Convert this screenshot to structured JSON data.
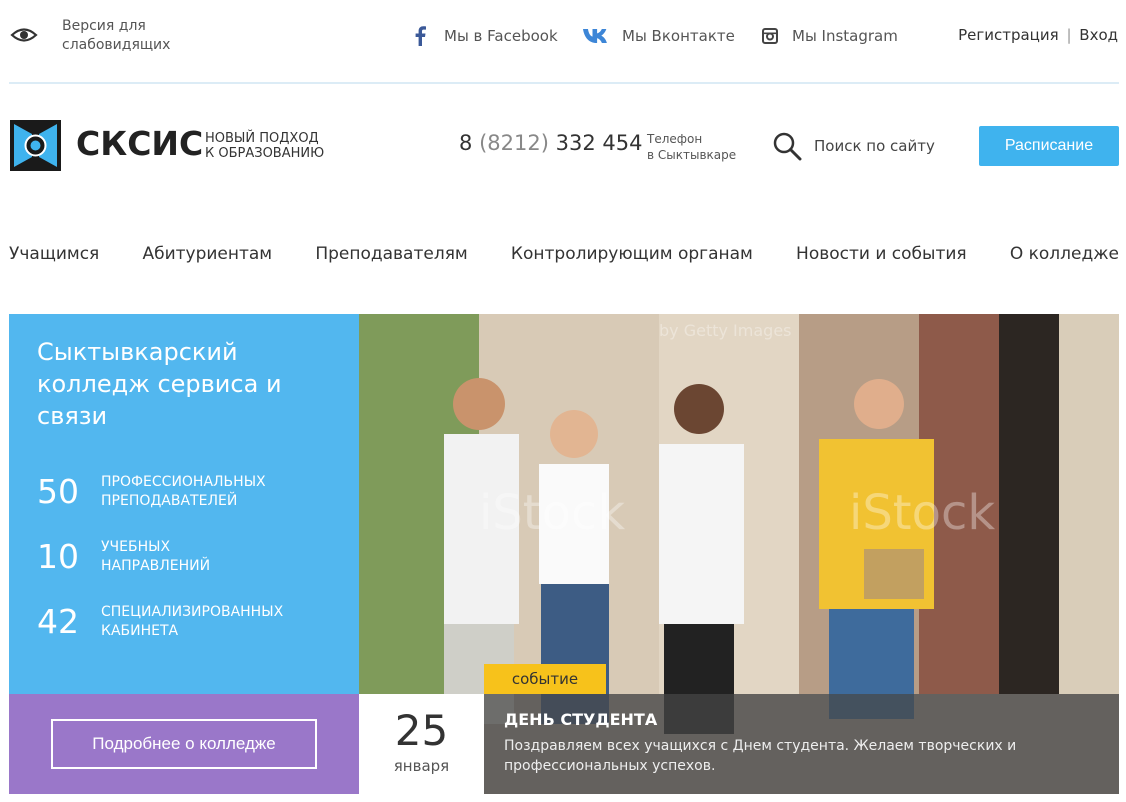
{
  "topbar": {
    "vision_label": "Версия для слабовидящих",
    "facebook_label": "Мы в Facebook",
    "vk_label": "Мы Вконтакте",
    "instagram_label": "Мы Instagram",
    "register_label": "Регистрация",
    "separator": "|",
    "login_label": "Вход"
  },
  "header": {
    "brand": "СКСИС",
    "tagline_line1": "НОВЫЙ ПОДХОД",
    "tagline_line2": "К ОБРАЗОВАНИЮ",
    "phone_prefix": "8",
    "phone_code": "(8212)",
    "phone_number": "332 454",
    "phone_label_line1": "Телефон",
    "phone_label_line2": "в Сыктывкаре",
    "search_label": "Поиск по сайту",
    "schedule_button": "Расписание"
  },
  "nav": {
    "items": [
      {
        "label": "Учащимся"
      },
      {
        "label": "Абитуриентам"
      },
      {
        "label": "Преподавателям"
      },
      {
        "label": "Контролирующим органам"
      },
      {
        "label": "Новости и события"
      },
      {
        "label": "О колледже"
      }
    ]
  },
  "hero": {
    "title": "Сыктывкарский колледж сервиса и связи",
    "stats": [
      {
        "number": "50",
        "line1": "ПРОФЕССИОНАЛЬНЫХ",
        "line2": "ПРЕПОДАВАТЕЛЕЙ"
      },
      {
        "number": "10",
        "line1": "УЧЕБНЫХ",
        "line2": "НАПРАВЛЕНИЙ"
      },
      {
        "number": "42",
        "line1": "СПЕЦИАЛИЗИРОВАННЫХ",
        "line2": "КАБИНЕТА"
      }
    ],
    "more_button": "Подробнее о колледже",
    "watermark": "iStock",
    "watermark_sub": "by Getty Images"
  },
  "event": {
    "tag": "событие",
    "day": "25",
    "month": "января",
    "title": "ДЕНЬ СТУДЕНТА",
    "text": "Поздравляем всех учащихся с Днем студента. Желаем творческих и профессиональных успехов."
  },
  "colors": {
    "accent_blue": "#3fb3ee",
    "panel_purple": "#9a77c9",
    "tag_yellow": "#f7c21b"
  },
  "icons": {
    "vision": "eye-icon",
    "facebook": "facebook-icon",
    "vk": "vk-icon",
    "instagram": "instagram-icon",
    "search": "search-icon",
    "logo": "logo-mark-icon"
  }
}
